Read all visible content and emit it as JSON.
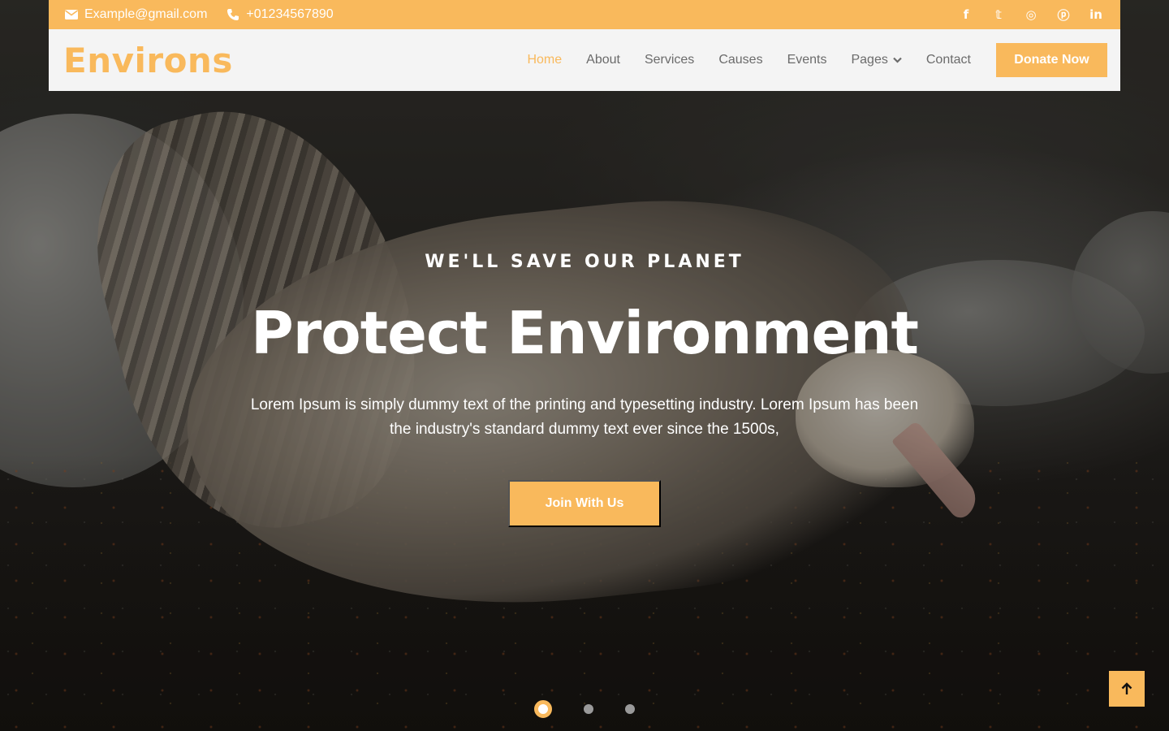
{
  "topbar": {
    "email": "Example@gmail.com",
    "phone": "+01234567890",
    "socials": [
      {
        "icon": "facebook-icon",
        "glyph": "f"
      },
      {
        "icon": "twitter-icon",
        "glyph": "𝕥"
      },
      {
        "icon": "instagram-icon",
        "glyph": "◎"
      },
      {
        "icon": "pinterest-icon",
        "glyph": "ⓟ"
      },
      {
        "icon": "linkedin-icon",
        "glyph": "in"
      }
    ]
  },
  "navbar": {
    "logo": "Environs",
    "items": [
      "Home",
      "About",
      "Services",
      "Causes",
      "Events",
      "Pages",
      "Contact"
    ],
    "active": "Home",
    "donate_label": "Donate Now"
  },
  "hero": {
    "kicker": "WE'LL SAVE OUR PLANET",
    "headline": "Protect Environment",
    "description": "Lorem Ipsum is simply dummy text of the printing and typesetting industry. Lorem Ipsum has been the industry's standard dummy text ever since the 1500s,",
    "cta_label": "Join With Us"
  },
  "carousel": {
    "active_slide": 1,
    "slide_count": 3
  },
  "colors": {
    "accent": "#f9b95c",
    "nav_bg": "#f4f4f4",
    "nav_text": "#6b6b6b"
  }
}
